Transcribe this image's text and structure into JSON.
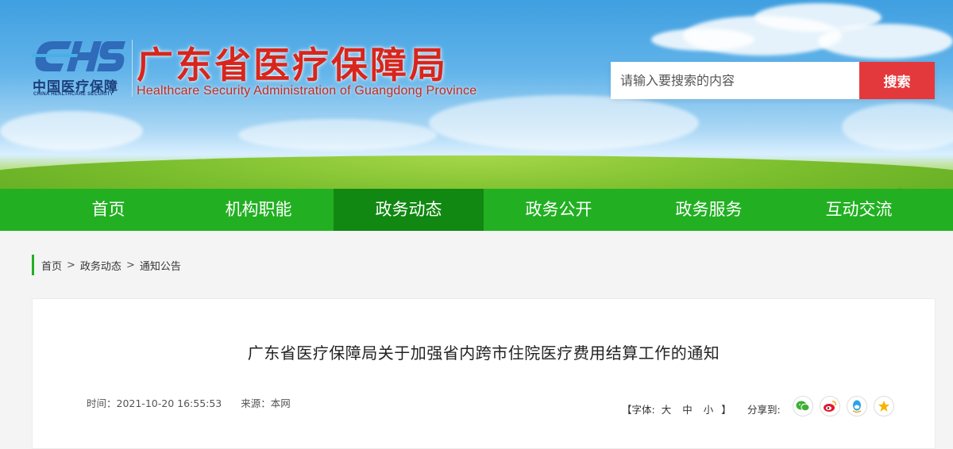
{
  "header": {
    "logo_cn": "中国医疗保障",
    "logo_en": "CHINA HEALTHCARE SECURITY",
    "site_title": "广东省医疗保障局",
    "site_subtitle": "Healthcare Security Administration of Guangdong Province"
  },
  "search": {
    "placeholder": "请输入要搜索的内容",
    "button_label": "搜索"
  },
  "nav": {
    "items": [
      {
        "label": "首页",
        "active": false
      },
      {
        "label": "机构职能",
        "active": false
      },
      {
        "label": "政务动态",
        "active": true
      },
      {
        "label": "政务公开",
        "active": false
      },
      {
        "label": "政务服务",
        "active": false
      },
      {
        "label": "互动交流",
        "active": false
      }
    ]
  },
  "breadcrumb": {
    "items": [
      "首页",
      "政务动态",
      "通知公告"
    ],
    "separator": ">"
  },
  "article": {
    "title": "广东省医疗保障局关于加强省内跨市住院医疗费用结算工作的通知",
    "time_label": "时间：2021-10-20 16:55:53",
    "source_label": "来源：本网",
    "font_size_prefix": "【字体:",
    "font_sizes": [
      "大",
      "中",
      "小"
    ],
    "font_size_suffix": "】",
    "share_label": "分享到:",
    "share_icons": [
      "wechat-icon",
      "weibo-icon",
      "qq-icon",
      "qzone-icon"
    ]
  },
  "colors": {
    "nav_bg": "#22b022",
    "nav_active": "#118811",
    "title_red": "#d7261d",
    "search_button": "#e4393c"
  }
}
